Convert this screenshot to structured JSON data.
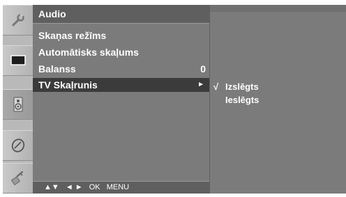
{
  "rail": {
    "icons": [
      {
        "name": "wrench-icon",
        "active": false
      },
      {
        "name": "picture-icon",
        "active": false
      },
      {
        "name": "speaker-icon",
        "active": true
      },
      {
        "name": "clock-icon",
        "active": false
      },
      {
        "name": "lock-icon",
        "active": false
      }
    ]
  },
  "menu": {
    "title": "Audio",
    "items": [
      {
        "label": "Skaņas režīms",
        "value": ""
      },
      {
        "label": "Automātisks skaļums",
        "value": ""
      },
      {
        "label": "Balanss",
        "value": "0"
      },
      {
        "label": "TV Skaļrunis",
        "value": "",
        "selected": true,
        "arrow": "►"
      }
    ]
  },
  "footer": {
    "nav_updown": "▲▼",
    "nav_leftright": "◄ ►",
    "ok": "OK",
    "menu": "MENU"
  },
  "submenu": {
    "options": [
      {
        "check": "√",
        "label": "Izslēgts",
        "checked": true
      },
      {
        "check": "",
        "label": "Ieslēgts",
        "checked": false
      }
    ]
  },
  "colors": {
    "panel": "#7b7b7b",
    "header": "#5f5f5f",
    "selected_row": "#3b3b3b",
    "rail": "#b9b9b9",
    "text": "#ffffff"
  }
}
